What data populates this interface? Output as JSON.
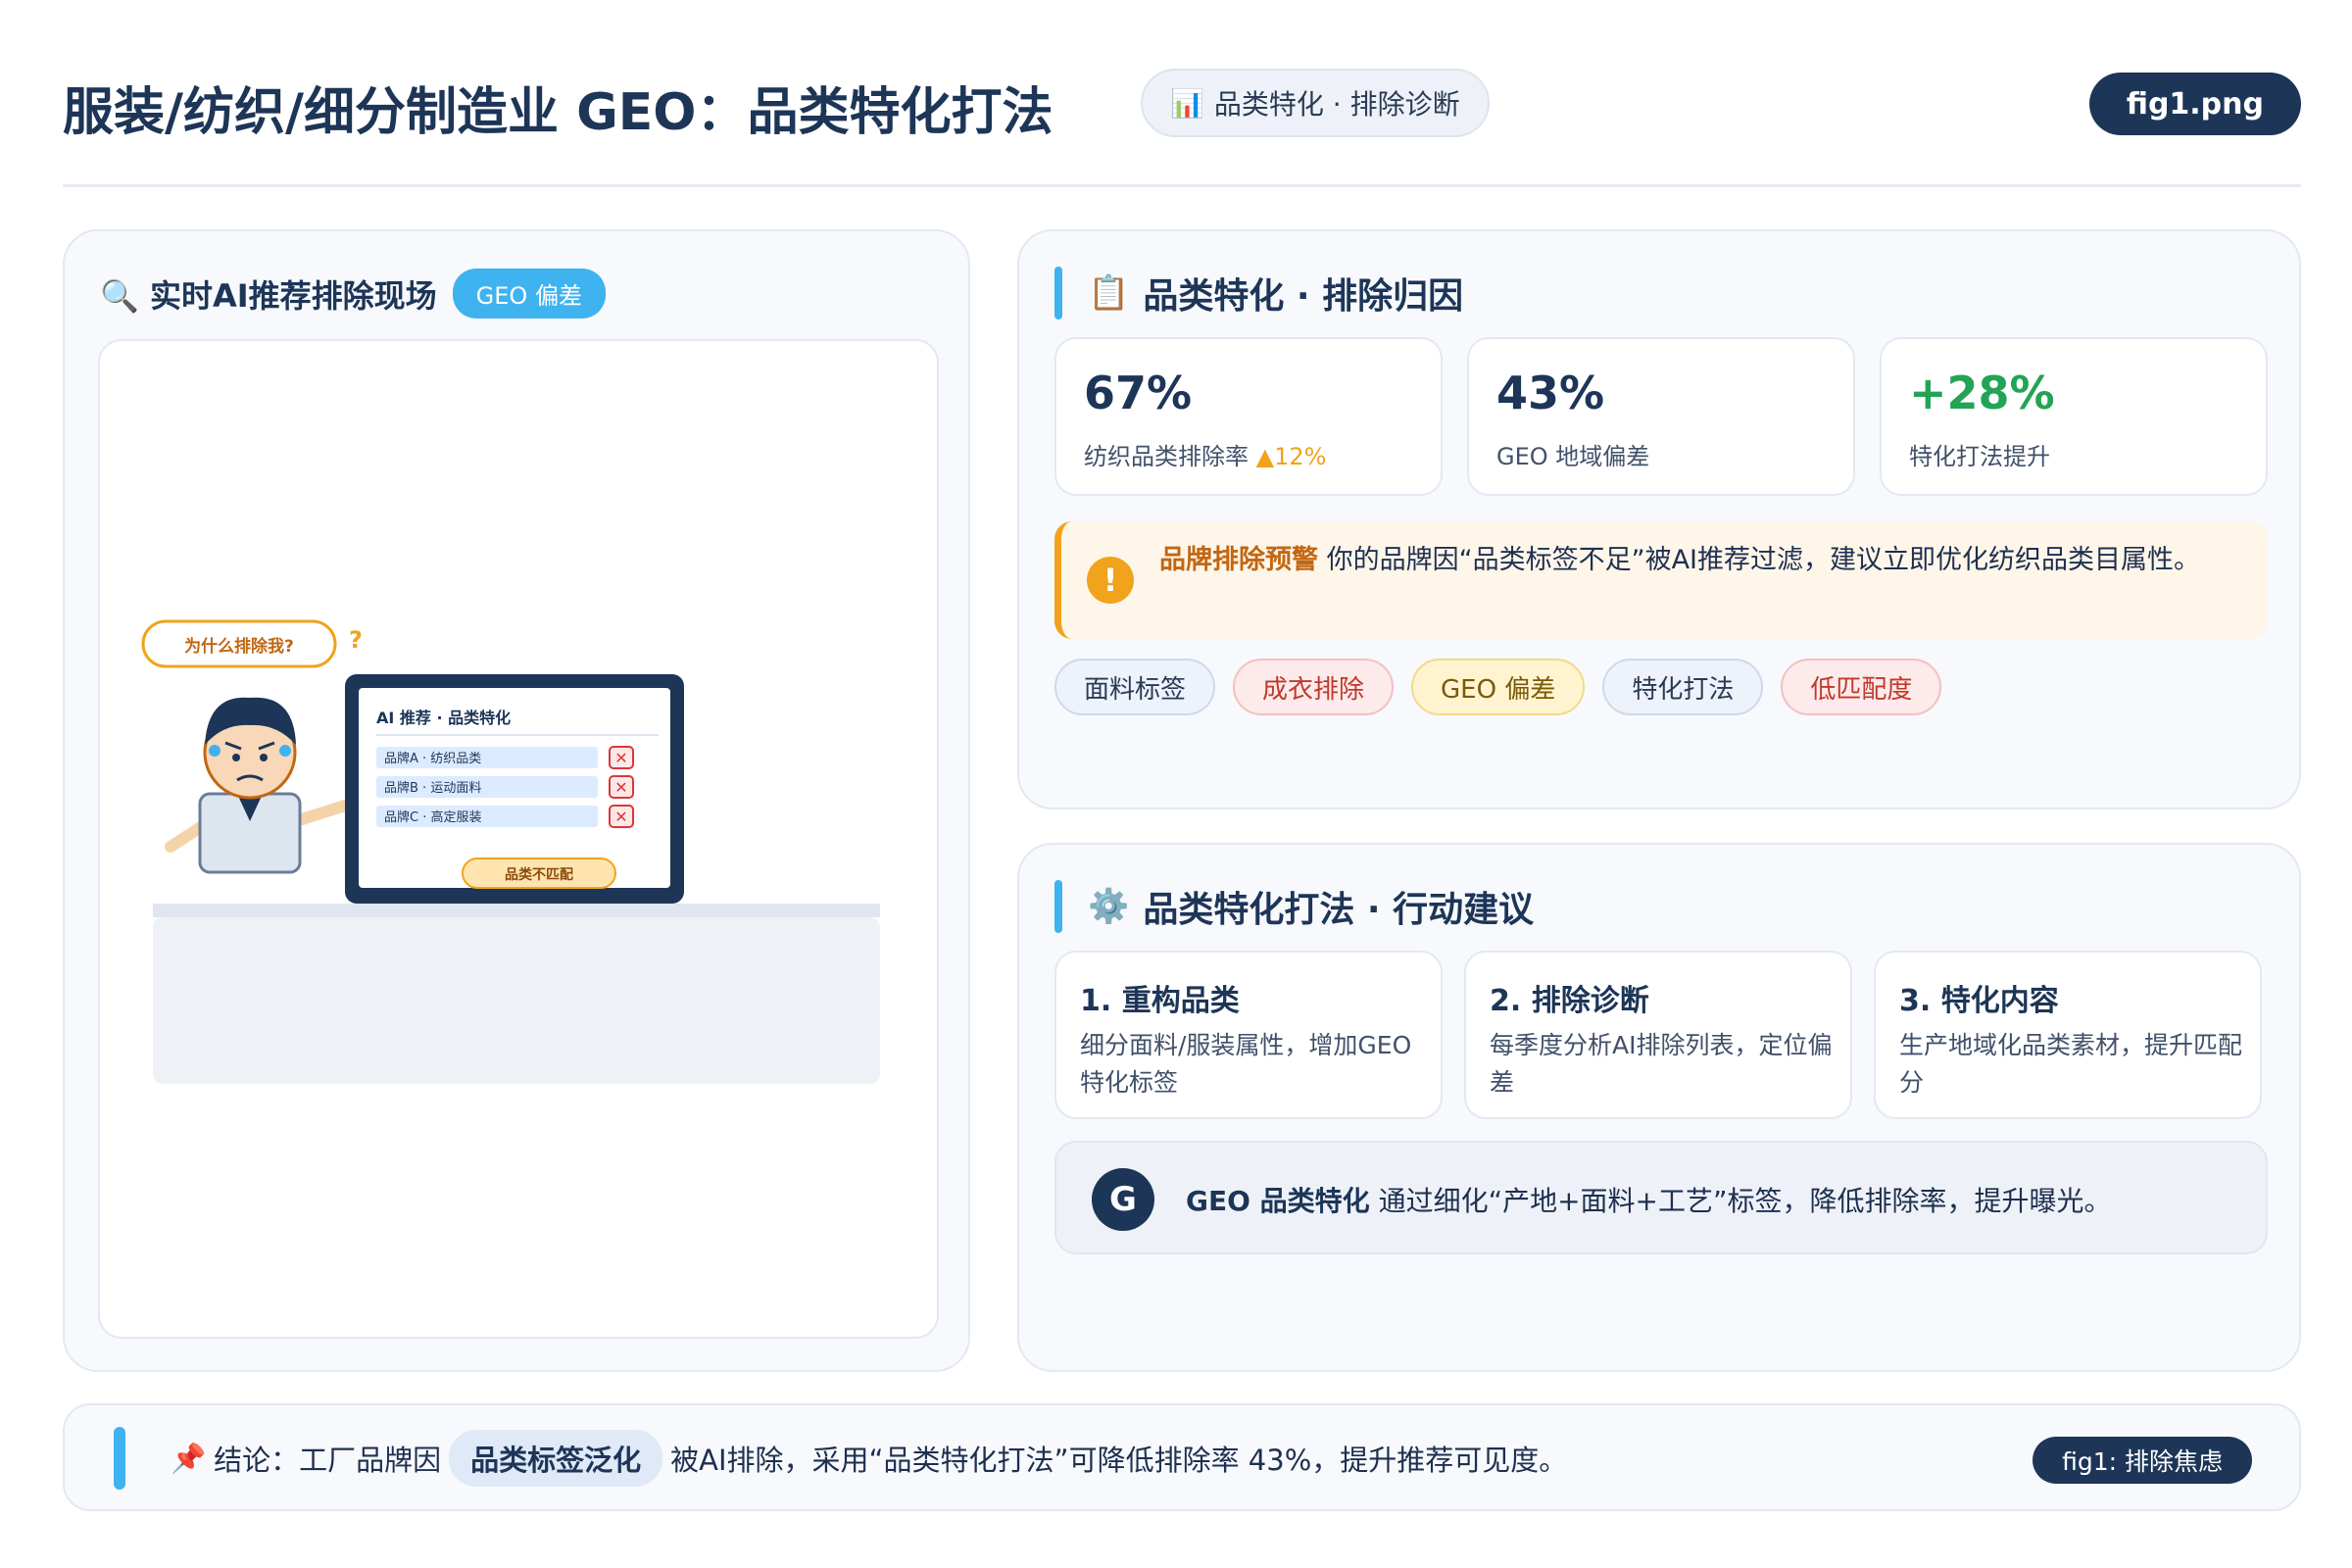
{
  "header": {
    "title": "服装/纺织/细分制造业 GEO：品类特化打法",
    "pill_icon": "📊",
    "pill_label": "品类特化 · 排除诊断",
    "fig_label": "fig1.png"
  },
  "left_panel": {
    "icon": "🔍",
    "title": "实时AI推荐排除现场",
    "badge": "GEO 偏差",
    "illustration": {
      "speech": "为什么排除我?",
      "question_mark": "?",
      "screen_title": "AI 推荐 · 品类特化",
      "list": [
        "品牌A · 纺织品类",
        "品牌B · 运动面料",
        "品牌C · 高定服装"
      ],
      "reject_mark": "✕",
      "mismatch_label": "品类不匹配"
    }
  },
  "attribution": {
    "icon": "📋",
    "title": "品类特化 · 排除归因",
    "stats": [
      {
        "value": "67%",
        "label": "纺织品类排除率",
        "delta": "▲12%"
      },
      {
        "value": "43%",
        "label": "GEO 地域偏差",
        "delta": ""
      },
      {
        "value": "+28%",
        "label": "特化打法提升",
        "delta": ""
      }
    ],
    "alert": {
      "icon": "!",
      "strong": "品牌排除预警",
      "text": "你的品牌因“品类标签不足”被AI推荐过滤，建议立即优化纺织品类目属性。"
    },
    "tags": [
      "面料标签",
      "成衣排除",
      "GEO 偏差",
      "特化打法",
      "低匹配度"
    ]
  },
  "actions": {
    "icon": "⚙️",
    "title": "品类特化打法 · 行动建议",
    "steps": [
      {
        "title": "1. 重构品类",
        "desc": "细分面料/服装属性，增加GEO特化标签"
      },
      {
        "title": "2. 排除诊断",
        "desc": "每季度分析AI排除列表，定位偏差"
      },
      {
        "title": "3. 特化内容",
        "desc": "生产地域化品类素材，提升匹配分"
      }
    ],
    "summary": {
      "badge": "G",
      "strong": "GEO 品类特化",
      "text": " 通过细化“产地+面料+工艺”标签，降低排除率，提升曝光。"
    }
  },
  "conclusion": {
    "icon": "📌",
    "prefix": "结论：工厂品牌因",
    "highlight": "品类标签泛化",
    "suffix": "被AI排除，采用“品类特化打法”可降低排除率 43%，提升推荐可见度。",
    "tag": "fig1: 排除焦虑"
  },
  "colors": {
    "navy": "#1d3557",
    "accent_blue": "#3fb2f0",
    "warning_orange": "#f0a31b",
    "success_green": "#23a455",
    "danger_red": "#d9383a"
  }
}
